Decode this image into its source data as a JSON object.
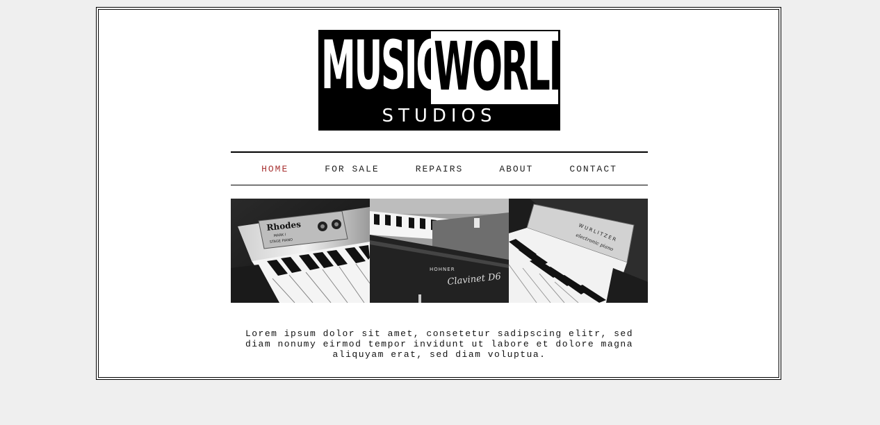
{
  "logo": {
    "line1_left": "MUSIC",
    "line1_right": "WORLD",
    "line2": "STUDIOS"
  },
  "nav": {
    "items": [
      {
        "label": "HOME",
        "active": true
      },
      {
        "label": "FOR SALE",
        "active": false
      },
      {
        "label": "REPAIRS",
        "active": false
      },
      {
        "label": "ABOUT",
        "active": false
      },
      {
        "label": "CONTACT",
        "active": false
      }
    ],
    "active_color": "#a83232"
  },
  "gallery": {
    "photos": [
      {
        "brand": "Rhodes",
        "model": "MARK I",
        "caption": "STAGE PIANO"
      },
      {
        "brand": "HOHNER",
        "model": "Clavinet D6"
      },
      {
        "brand": "WURLITZER",
        "model": "electronic piano"
      }
    ]
  },
  "intro": {
    "text": "Lorem ipsum dolor sit amet, consetetur sadipscing elitr, sed diam nonumy eirmod tempor invidunt ut labore et dolore magna aliquyam erat, sed diam voluptua."
  }
}
